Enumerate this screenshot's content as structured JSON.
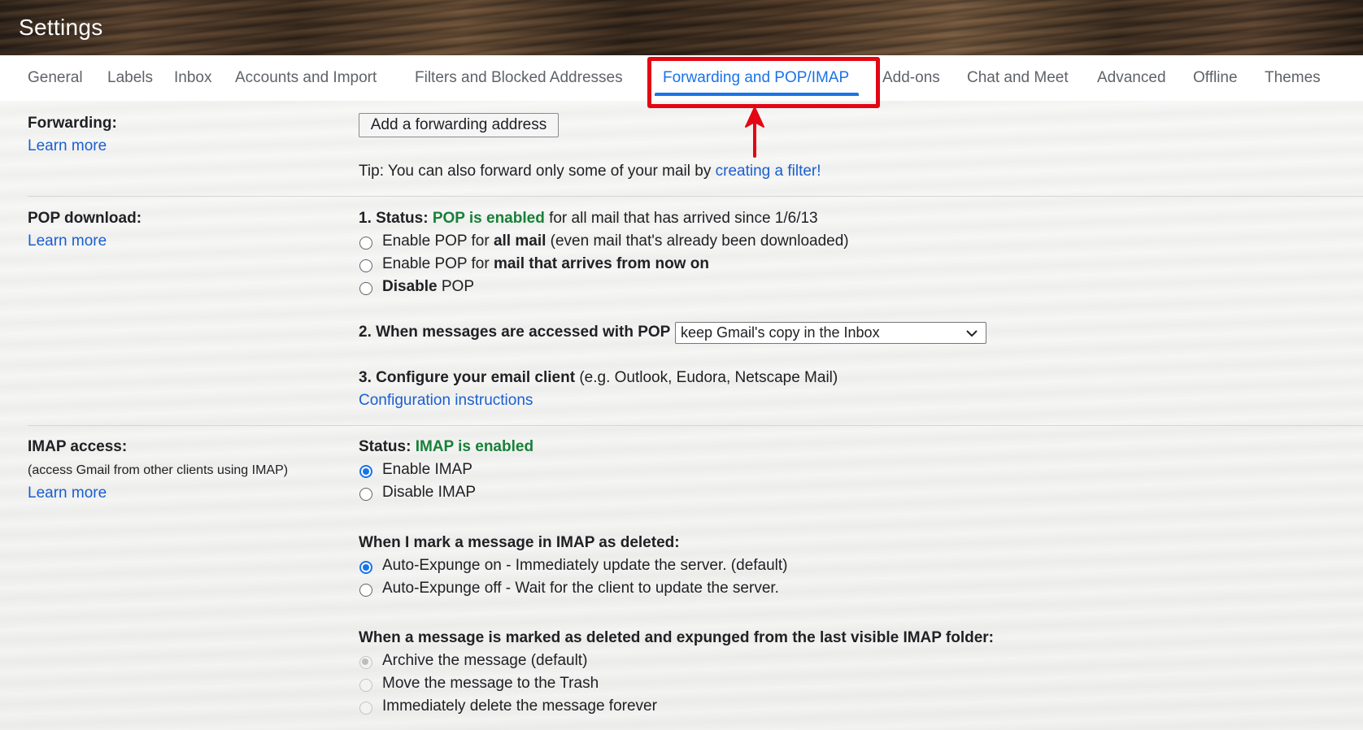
{
  "header": {
    "title": "Settings"
  },
  "tabs": [
    "General",
    "Labels",
    "Inbox",
    "Accounts and Import",
    "Filters and Blocked Addresses",
    "Forwarding and POP/IMAP",
    "Add-ons",
    "Chat and Meet",
    "Advanced",
    "Offline",
    "Themes"
  ],
  "active_tab": "Forwarding and POP/IMAP",
  "forwarding": {
    "label": "Forwarding:",
    "learn_more": "Learn more",
    "add_button": "Add a forwarding address",
    "tip_prefix": "Tip: You can also forward only some of your mail by ",
    "tip_link": "creating a filter!"
  },
  "pop": {
    "label": "POP download:",
    "learn_more": "Learn more",
    "status_prefix": "1. Status: ",
    "status_value": "POP is enabled",
    "status_suffix": " for all mail that has arrived since 1/6/13",
    "options": [
      {
        "pre": "Enable POP for ",
        "bold": "all mail",
        "post": " (even mail that's already been downloaded)"
      },
      {
        "pre": "Enable POP for ",
        "bold": "mail that arrives from now on",
        "post": ""
      },
      {
        "pre": "",
        "bold": "Disable",
        "post": " POP"
      }
    ],
    "access_label": "2. When messages are accessed with POP",
    "access_selected": "keep Gmail's copy in the Inbox",
    "configure_label": "3. Configure your email client",
    "configure_suffix": " (e.g. Outlook, Eudora, Netscape Mail)",
    "config_link": "Configuration instructions"
  },
  "imap": {
    "label": "IMAP access:",
    "sublabel": "(access Gmail from other clients using IMAP)",
    "learn_more": "Learn more",
    "status_prefix": "Status: ",
    "status_value": "IMAP is enabled",
    "enable": "Enable IMAP",
    "disable": "Disable IMAP",
    "enabled": true,
    "deleted_heading": "When I mark a message in IMAP as deleted:",
    "expunge_on": "Auto-Expunge on - Immediately update the server. (default)",
    "expunge_off": "Auto-Expunge off - Wait for the client to update the server.",
    "expunged_heading": "When a message is marked as deleted and expunged from the last visible IMAP folder:",
    "archive": "Archive the message (default)",
    "trash": "Move the message to the Trash",
    "delete_forever": "Immediately delete the message forever"
  },
  "colors": {
    "accent": "#1a73e8",
    "link": "#1a5fd0",
    "status_green": "#188038",
    "annotation_red": "#e30613"
  },
  "icons": {
    "dropdown": "chevron-down-icon",
    "annotation": "red-arrow-icon"
  }
}
